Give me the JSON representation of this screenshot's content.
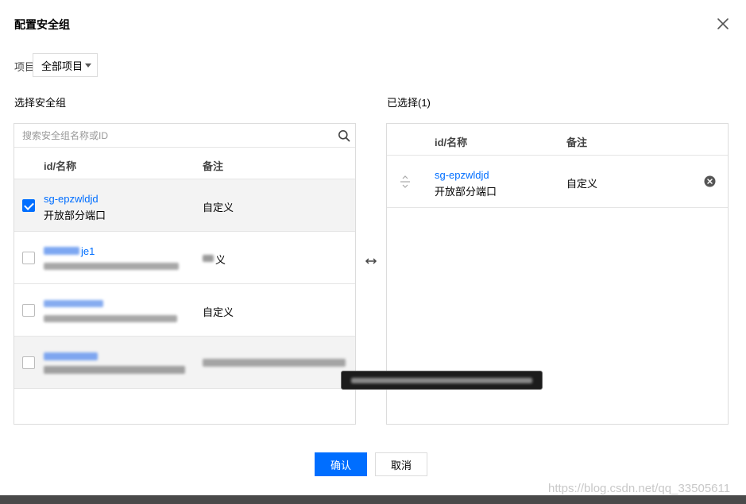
{
  "dialog": {
    "title": "配置安全组"
  },
  "filter": {
    "project_label": "项目",
    "project_value": "全部项目"
  },
  "left": {
    "title": "选择安全组",
    "search_placeholder": "搜索安全组名称或ID",
    "col_id": "id/名称",
    "col_note": "备注",
    "rows": [
      {
        "id": "sg-epzwldjd",
        "desc": "开放部分端口",
        "note": "自定义",
        "checked": true
      },
      {
        "id": "je1",
        "desc": "",
        "note": "义",
        "checked": false
      },
      {
        "id": "",
        "desc": "",
        "note": "自定义",
        "checked": false
      },
      {
        "id": "",
        "desc": "",
        "note": "",
        "checked": false
      }
    ]
  },
  "right": {
    "title": "已选择(1)",
    "col_id": "id/名称",
    "col_note": "备注",
    "rows": [
      {
        "id": "sg-epzwldjd",
        "desc": "开放部分端口",
        "note": "自定义"
      }
    ]
  },
  "footer": {
    "confirm_label": "确认",
    "cancel_label": "取消"
  },
  "watermark": "https://blog.csdn.net/qq_33505611",
  "colors": {
    "accent": "#006eff",
    "border": "#dcdcdc",
    "row_highlight": "#f3f3f3"
  },
  "icons": [
    "close-icon",
    "chevron-down-icon",
    "search-icon",
    "checkbox-checked-icon",
    "transfer-arrows-icon",
    "drag-handle-icon",
    "remove-circle-icon"
  ]
}
